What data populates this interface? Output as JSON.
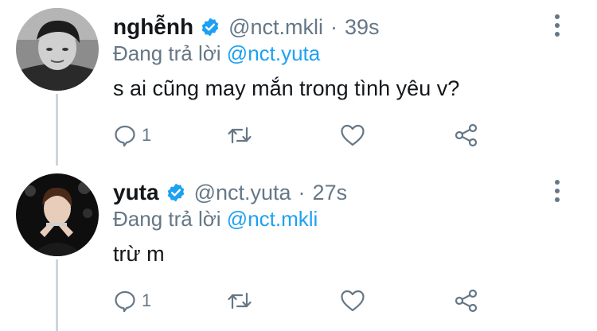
{
  "tweets": [
    {
      "name": "nghễnh",
      "handle": "@nct.mkli",
      "separator": "·",
      "time": "39s",
      "reply_prefix": "Đang trả lời",
      "reply_to": "@nct.yuta",
      "text": "s ai cũng may mắn trong tình yêu v?",
      "reply_count": "1",
      "verified_icon": "verified-badge-icon",
      "avatar_icon": "avatar-photo"
    },
    {
      "name": "yuta",
      "handle": "@nct.yuta",
      "separator": "·",
      "time": "27s",
      "reply_prefix": "Đang trả lời",
      "reply_to": "@nct.mkli",
      "text": "trừ m",
      "reply_count": "1",
      "verified_icon": "verified-badge-icon",
      "avatar_icon": "avatar-photo"
    }
  ],
  "colors": {
    "accent": "#1da1f2",
    "text": "#14171a",
    "secondary": "#657786",
    "thread_line": "#cdd5dc"
  }
}
